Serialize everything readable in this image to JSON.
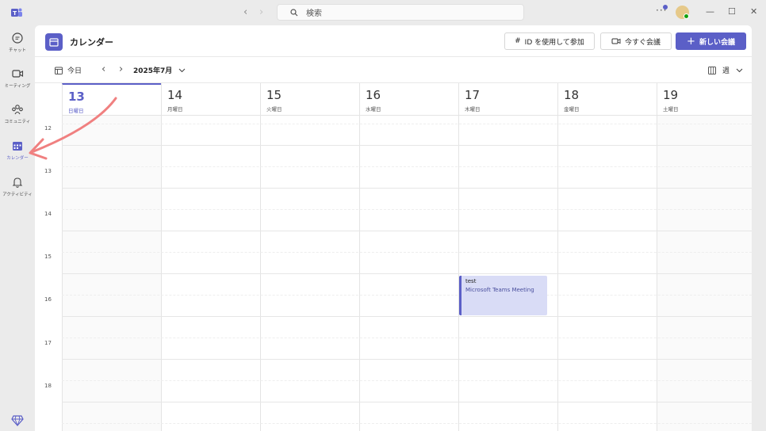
{
  "titlebar": {
    "search_placeholder": "検索"
  },
  "rail": {
    "items": [
      {
        "label": "チャット",
        "icon": "chat-icon"
      },
      {
        "label": "ミーティング",
        "icon": "video-icon"
      },
      {
        "label": "コミュニティ",
        "icon": "community-icon"
      },
      {
        "label": "カレンダー",
        "icon": "calendar-icon"
      },
      {
        "label": "アクティビティ",
        "icon": "bell-icon"
      }
    ]
  },
  "header": {
    "title": "カレンダー",
    "join_label": "ID を使用して参加",
    "meet_now_label": "今すぐ会議",
    "new_meeting_label": "新しい会議"
  },
  "toolbar": {
    "today_label": "今日",
    "month_label": "2025年7月",
    "view_label": "週"
  },
  "days": [
    {
      "num": "13",
      "name": "日曜日"
    },
    {
      "num": "14",
      "name": "月曜日"
    },
    {
      "num": "15",
      "name": "火曜日"
    },
    {
      "num": "16",
      "name": "水曜日"
    },
    {
      "num": "17",
      "name": "木曜日"
    },
    {
      "num": "18",
      "name": "金曜日"
    },
    {
      "num": "19",
      "name": "土曜日"
    }
  ],
  "hours": [
    "12",
    "13",
    "14",
    "15",
    "16",
    "17",
    "18"
  ],
  "event": {
    "title": "test",
    "subtitle": "Microsoft Teams Meeting"
  },
  "colors": {
    "accent": "#5b5fc7",
    "annotation_arrow": "#f08080"
  }
}
